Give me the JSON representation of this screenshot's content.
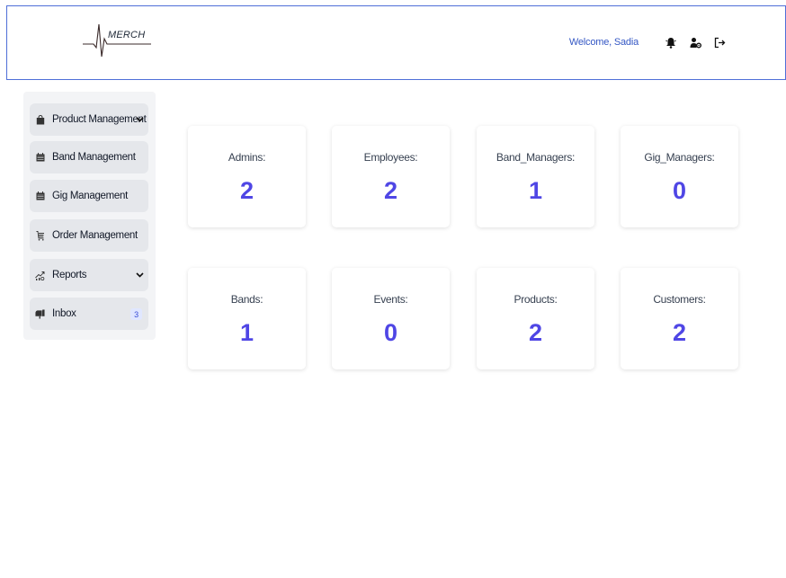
{
  "header": {
    "logo_text": "MERCH",
    "welcome": "Welcome, Sadia",
    "icons": [
      "bell-icon",
      "user-settings-icon",
      "logout-icon"
    ]
  },
  "sidebar": {
    "items": [
      {
        "label": "Product Management",
        "icon": "shopping-bag-icon",
        "has_dropdown": true
      },
      {
        "label": "Band Management",
        "icon": "calendar-icon"
      },
      {
        "label": "Gig Management",
        "icon": "calendar-icon"
      },
      {
        "label": "Order Management",
        "icon": "cart-icon"
      },
      {
        "label": "Reports",
        "icon": "chart-icon",
        "has_dropdown": true
      },
      {
        "label": "Inbox",
        "icon": "mailbox-icon",
        "badge": "3"
      }
    ]
  },
  "stats": [
    {
      "label": "Admins:",
      "value": "2"
    },
    {
      "label": "Employees:",
      "value": "2"
    },
    {
      "label": "Band_Managers:",
      "value": "1"
    },
    {
      "label": "Gig_Managers:",
      "value": "0"
    },
    {
      "label": "Bands:",
      "value": "1"
    },
    {
      "label": "Events:",
      "value": "0"
    },
    {
      "label": "Products:",
      "value": "2"
    },
    {
      "label": "Customers:",
      "value": "2"
    }
  ],
  "colors": {
    "accent": "#4f46e5",
    "welcome": "#3457c4",
    "header_border": "#4f6fd8"
  }
}
